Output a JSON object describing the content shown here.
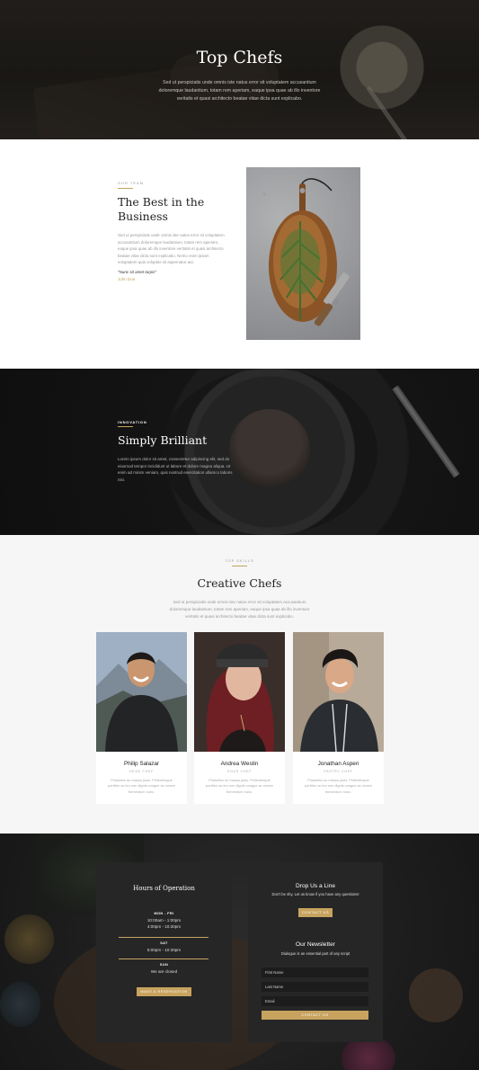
{
  "hero": {
    "title": "Top Chefs",
    "text": "Sed ut perspiciatis unde omnis iste natus error sit voluptatem accusantium doloremque laudantium, totam rem aperiam, eaque ipsa quae ab illo inventore veritatis et quasi architecto beatae vitae dicta sunt explicabo."
  },
  "best": {
    "eyebrow": "OUR TEAM",
    "title": "The Best in the Business",
    "text": "Sed ut perspiciatis unde omnis iste natus error sit voluptatem accusantium doloremque laudantium, totam rem aperiam, eaque ipsa quae ab illo inventore veritatis et quasi architecto beatae vitae dicta sunt explicabo. Nemo enim ipsam voluptatem quia voluptas sit aspernatur aut.",
    "quote": "\"Nunc sit amet turpis\"",
    "author": "John Doe"
  },
  "brilliant": {
    "eyebrow": "INNOVATION",
    "title": "Simply Brilliant",
    "text": "Lorem ipsum dolor sit amet, consectetur adipiscing elit, sed do eiusmod tempor incididunt ut labore et dolore magna aliqua. Ut enim ad minim veniam, quis nostrud exercitation ullamco laboris nisi."
  },
  "creative": {
    "eyebrow": "TOP SKILLS",
    "title": "Creative Chefs",
    "text": "Sed ut perspiciatis unde omnis iste natus error sit voluptatem accusantium doloremque laudantium, totam rem aperiam, eaque ipsa quae ab illo inventore veritatis et quasi architecto beatae vitae dicta sunt explicabo.",
    "chefs": [
      {
        "name": "Philip Salazar",
        "role": "HEAD CHEF",
        "desc": "Phasellus ac massa justo. Pellentesque porttitor ac leo non dignis congue ac ornare fermentum nunc."
      },
      {
        "name": "Andrea Westin",
        "role": "SOUS CHEF",
        "desc": "Phasellus ac massa justo. Pellentesque porttitor ac leo non dignis congue ac ornare fermentum nunc."
      },
      {
        "name": "Jonathan Aspen",
        "role": "PASTRY CHEF",
        "desc": "Phasellus ac massa justo. Pellentesque porttitor ac leo non dignis congue ac ornare fermentum nunc."
      }
    ]
  },
  "hours": {
    "title": "Hours of Operation",
    "days1": "MON - FRI",
    "times1a": "10:00am - 1:00pm",
    "times1b": "4:00pm - 10:30pm",
    "days2": "SAT",
    "times2": "5:00pm - 10:30pm",
    "days3": "SUN",
    "times3": "We are closed",
    "button": "MAKE A RESERVATION"
  },
  "contact": {
    "title": "Drop Us a Line",
    "text": "Don't be shy. Let us know if you have any questions!",
    "button": "CONTACT US"
  },
  "newsletter": {
    "title": "Our Newsletter",
    "text": "Dialogue is an essential part of any script",
    "first_placeholder": "First Name",
    "last_placeholder": "Last Name",
    "email_placeholder": "Email",
    "button": "CONTACT US"
  },
  "colors": {
    "accent": "#c7a35f",
    "dark_panel": "#262626",
    "light_bg": "#f6f6f6"
  }
}
